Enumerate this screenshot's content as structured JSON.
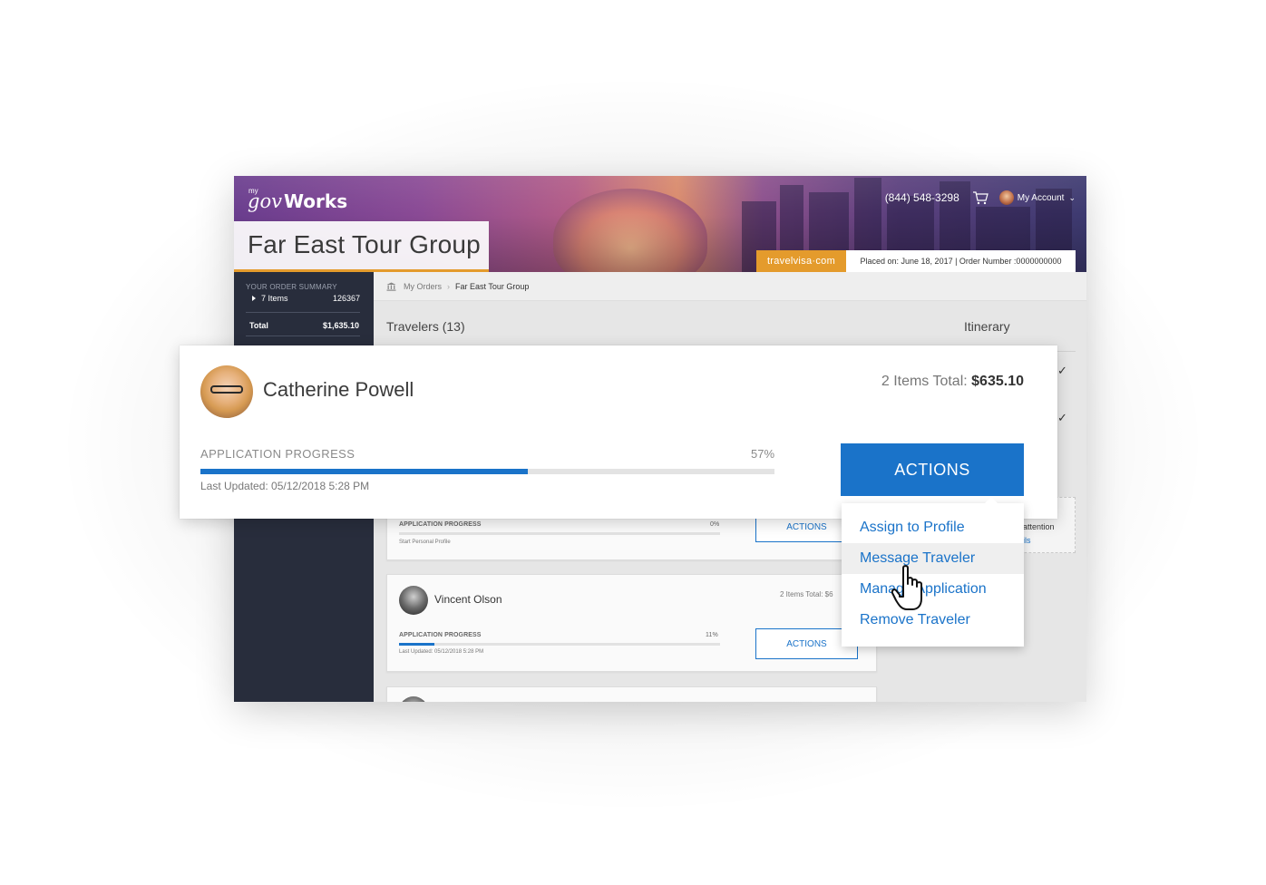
{
  "header": {
    "logo_my": "my",
    "logo_gov": "gov",
    "logo_works": "Works",
    "phone": "(844) 548-3298",
    "account_label": "My Account",
    "page_title": "Far East Tour Group",
    "partner_badge": "travelvisa·com",
    "order_info": "Placed on: June 18, 2017   |   Order Number :0000000000"
  },
  "sidebar": {
    "summary_label": "YOUR ORDER SUMMARY",
    "items_label": "7 Items",
    "items_value": "126367",
    "total_label": "Total",
    "total_value": "$1,635.10"
  },
  "breadcrumb": {
    "root": "My Orders",
    "sep": "›",
    "current": "Far East Tour Group"
  },
  "main": {
    "travelers_heading": "Travelers (13)",
    "itinerary_heading": "Itinerary",
    "check_glyph": "✓",
    "attention_text": "attention",
    "attention_link": "ils"
  },
  "featured_traveler": {
    "name": "Catherine Powell",
    "items_total_label": "2 Items Total: ",
    "items_total_value": "$635.10",
    "progress_label": "APPLICATION PROGRESS",
    "progress_pct_text": "57%",
    "progress_value": 0.57,
    "last_updated": "Last Updated: 05/12/2018  5:28 PM",
    "actions_label": "ACTIONS"
  },
  "traveler_cards": [
    {
      "progress_label": "APPLICATION PROGRESS",
      "progress_pct_text": "0%",
      "progress_value": 0.0,
      "subtext": "Start Personal Profile",
      "actions_label": "ACTIONS"
    },
    {
      "name": "Vincent Olson",
      "items_total": "2 Items Total: $6",
      "progress_label": "APPLICATION PROGRESS",
      "progress_pct_text": "11%",
      "progress_value": 0.11,
      "subtext": "Last Updated: 05/12/2018  5:28 PM",
      "actions_label": "ACTIONS"
    }
  ],
  "actions_menu": {
    "items": [
      {
        "label": "Assign to Profile"
      },
      {
        "label": "Message Traveler",
        "hovered": true
      },
      {
        "label": "Manage Application"
      },
      {
        "label": "Remove Traveler"
      }
    ]
  },
  "colors": {
    "accent": "#1a73c9",
    "sidebar_bg": "#282d3c",
    "badge": "#e49b2c"
  }
}
